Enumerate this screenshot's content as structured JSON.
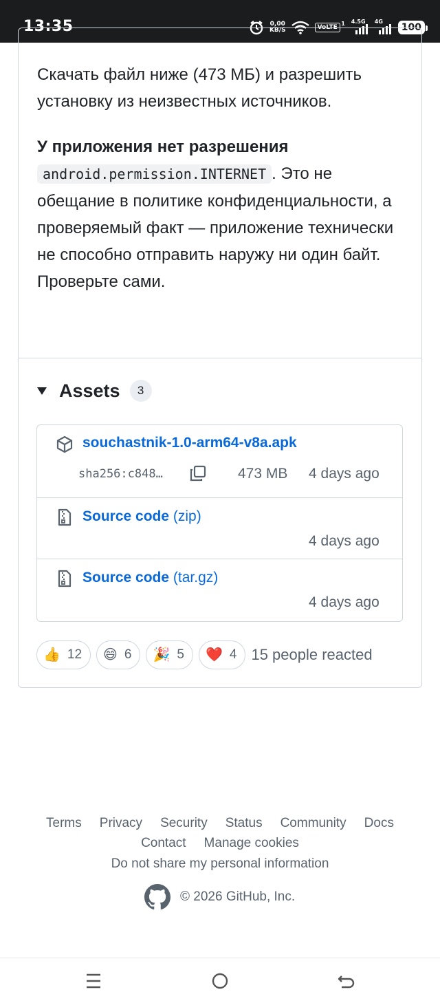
{
  "status_bar": {
    "time": "13:35",
    "net_speed_value": "0,00",
    "net_speed_unit": "KB/S",
    "volte": "VoLTE",
    "volte_sim": "1",
    "net1_label": "4.5G",
    "net2_label": "4G",
    "battery": "100",
    "icons": [
      "alarm-icon",
      "wifi-icon",
      "signal-icon"
    ]
  },
  "release": {
    "paragraph1": "Скачать файл ниже (473 МБ) и разрешить установку из неизвестных источников.",
    "p2_bold": "У приложения нет разрешения",
    "p2_code": "android.permission.INTERNET",
    "p2_rest": ". Это не обещание в политике конфиденциальности, а проверяемый факт — приложение технически не способно отправить наружу ни один байт. Проверьте сами."
  },
  "assets": {
    "title": "Assets",
    "count": "3",
    "items": [
      {
        "icon": "package-icon",
        "name": "souchastnik-1.0-arm64-v8a.apk",
        "sha": "sha256:c848…",
        "size": "473 MB",
        "date": "4 days ago"
      },
      {
        "icon": "file-zip-icon",
        "name": "Source code",
        "suffix": "(zip)",
        "date": "4 days ago"
      },
      {
        "icon": "file-zip-icon",
        "name": "Source code",
        "suffix": "(tar.gz)",
        "date": "4 days ago"
      }
    ]
  },
  "reactions": {
    "items": [
      {
        "emoji": "👍",
        "count": "12"
      },
      {
        "emoji": "😄",
        "count": "6"
      },
      {
        "emoji": "🎉",
        "count": "5"
      },
      {
        "emoji": "❤️",
        "count": "4"
      }
    ],
    "summary": "15 people reacted"
  },
  "footer": {
    "links_row1": [
      "Terms",
      "Privacy",
      "Security",
      "Status",
      "Community",
      "Docs"
    ],
    "links_row2": [
      "Contact",
      "Manage cookies"
    ],
    "links_row3": [
      "Do not share my personal information"
    ],
    "copyright": "© 2026 GitHub, Inc."
  },
  "colors": {
    "link": "#0969da",
    "muted": "#59636e",
    "border": "#d0d7de",
    "statusbar": "#1b1c1e"
  }
}
